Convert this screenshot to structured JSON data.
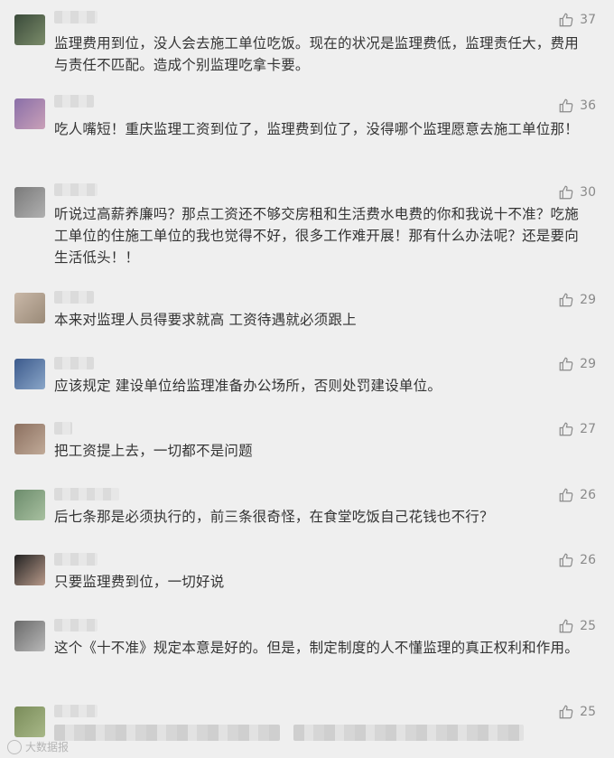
{
  "comments": [
    {
      "text": "监理费用到位，没人会去施工单位吃饭。现在的状况是监理费低，监理责任大，费用与责任不匹配。造成个别监理吃拿卡要。",
      "likes": "37",
      "avatar_colors": [
        "#3a4a3a",
        "#7b8c6a"
      ]
    },
    {
      "text": "吃人嘴短！重庆监理工资到位了，监理费到位了，没得哪个监理愿意去施工单位那！",
      "likes": "36",
      "avatar_colors": [
        "#8a6fa8",
        "#c9a0b8"
      ]
    },
    {
      "text": "听说过高薪养廉吗？那点工资还不够交房租和生活费水电费的你和我说十不准？吃施工单位的住施工单位的我也觉得不好，很多工作难开展！那有什么办法呢？还是要向生活低头！！",
      "likes": "30",
      "avatar_colors": [
        "#7a7a7a",
        "#b0b0b0"
      ]
    },
    {
      "text": "本来对监理人员得要求就高 工资待遇就必须跟上",
      "likes": "29",
      "avatar_colors": [
        "#c9b8a8",
        "#9a8a78"
      ]
    },
    {
      "text": "应该规定 建设单位给监理准备办公场所，否则处罚建设单位。",
      "likes": "29",
      "avatar_colors": [
        "#3c5a8c",
        "#8aa6c8"
      ]
    },
    {
      "text": "把工资提上去，一切都不是问题",
      "likes": "27",
      "avatar_colors": [
        "#8c7060",
        "#c0aa98"
      ]
    },
    {
      "text": "后七条那是必须执行的，前三条很奇怪，在食堂吃饭自己花钱也不行？",
      "likes": "26",
      "avatar_colors": [
        "#6c8c6c",
        "#a8c0a0"
      ]
    },
    {
      "text": "只要监理费到位，一切好说",
      "likes": "26",
      "avatar_colors": [
        "#222222",
        "#b89a8a"
      ]
    },
    {
      "text": "这个《十不准》规定本意是好的。但是，制定制度的人不懂监理的真正权利和作用。",
      "likes": "25",
      "avatar_colors": [
        "#6a6a6a",
        "#b8b8b8"
      ]
    },
    {
      "text": "",
      "likes": "25",
      "avatar_colors": [
        "#7a8c5a",
        "#a8b888"
      ]
    }
  ],
  "watermark": "大数据报",
  "icons": {
    "like": "thumbs-up-icon"
  }
}
